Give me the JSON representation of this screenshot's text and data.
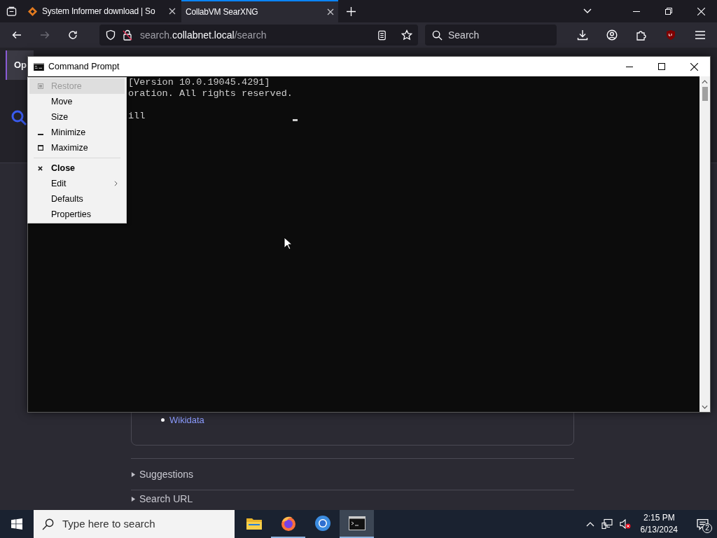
{
  "browser": {
    "tabs": [
      {
        "title": "System Informer download | So",
        "selected": false
      },
      {
        "title": "CollabVM SearXNG",
        "selected": true
      }
    ],
    "nav_buttons": [
      {
        "kind": "back",
        "disabled": false
      },
      {
        "kind": "forward",
        "disabled": true
      },
      {
        "kind": "reload",
        "disabled": false
      }
    ],
    "address": {
      "prefix": "search.",
      "host": "collabnet.local",
      "path": "/search"
    },
    "search": {
      "placeholder": "Search"
    }
  },
  "page": {
    "tab_label": "Op",
    "links": [
      "Wikidata"
    ],
    "sections": [
      {
        "label": "Suggestions",
        "expanded": false
      },
      {
        "label": "Search URL",
        "expanded": false
      }
    ]
  },
  "console": {
    "title": "Command Prompt",
    "output": "[Version 10.0.19045.4291]\noration. All rights reserved.\n\nill"
  },
  "menu": [
    {
      "label": "Restore",
      "kind": "restore",
      "disabled": true,
      "selected": true
    },
    {
      "label": "Move",
      "kind": "plain",
      "disabled": false,
      "selected": false
    },
    {
      "label": "Size",
      "kind": "plain",
      "disabled": false,
      "selected": false
    },
    {
      "label": "Minimize",
      "kind": "minimize",
      "disabled": false,
      "selected": false
    },
    {
      "label": "Maximize",
      "kind": "maximize",
      "disabled": false,
      "selected": false
    },
    {
      "label": "Close",
      "kind": "close",
      "disabled": false,
      "selected": false
    },
    {
      "label": "Edit",
      "kind": "submenu",
      "disabled": false,
      "selected": false
    },
    {
      "label": "Defaults",
      "kind": "plain",
      "disabled": false,
      "selected": false
    },
    {
      "label": "Properties",
      "kind": "plain",
      "disabled": false,
      "selected": false
    }
  ],
  "taskbar": {
    "search_placeholder": "Type here to search",
    "apps": [
      {
        "kind": "explorer",
        "selected": false
      },
      {
        "kind": "firefox",
        "selected": false
      },
      {
        "kind": "chrome",
        "selected": false
      },
      {
        "kind": "terminal",
        "selected": true
      }
    ],
    "time": "2:15 PM",
    "date": "6/13/2024",
    "notifications": "2"
  }
}
